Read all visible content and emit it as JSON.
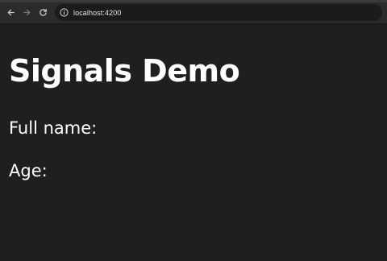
{
  "browser": {
    "url": "localhost:4200",
    "icons": {
      "back": "arrow-left-icon",
      "forward": "arrow-right-icon",
      "reload": "reload-icon",
      "info": "info-icon"
    }
  },
  "page": {
    "title": "Signals Demo",
    "fields": {
      "full_name_label": "Full name:",
      "age_label": "Age:"
    }
  },
  "colors": {
    "background": "#1f1f1f",
    "toolbar": "#2b2b2b",
    "text": "#ffffff"
  }
}
